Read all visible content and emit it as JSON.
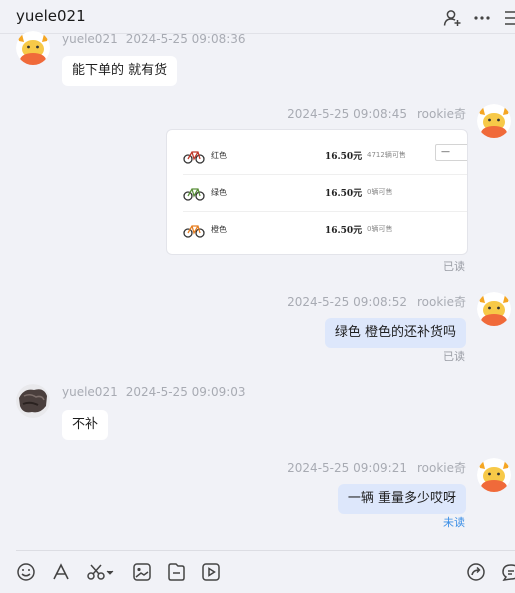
{
  "header": {
    "title": "yuele021",
    "icons": [
      "add-contact-icon",
      "more-icon",
      "menu-icon"
    ]
  },
  "messages": [
    {
      "sender": "yuele021",
      "time": "2024-5-25 09:08:36",
      "side": "left",
      "avatar": "ox-avatar",
      "text": "能下单的 就有货"
    },
    {
      "sender": "rookie奇",
      "time": "2024-5-25 09:08:45",
      "side": "right",
      "avatar": "ox-avatar",
      "type": "product-card",
      "card": {
        "rows": [
          {
            "color": "红色",
            "price": "16.50元",
            "stock": "4712辆可售",
            "qty": "—"
          },
          {
            "color": "绿色",
            "price": "16.50元",
            "stock": "0辆可售",
            "qty": ""
          },
          {
            "color": "橙色",
            "price": "16.50元",
            "stock": "0辆可售",
            "qty": ""
          }
        ]
      },
      "status": "已读"
    },
    {
      "sender": "rookie奇",
      "time": "2024-5-25 09:08:52",
      "side": "right",
      "avatar": "ox-avatar",
      "text": "绿色  橙色的还补货吗",
      "status": "已读"
    },
    {
      "sender": "yuele021",
      "time": "2024-5-25 09:09:03",
      "side": "left",
      "avatar": "photo-avatar",
      "text": "不补"
    },
    {
      "sender": "rookie奇",
      "time": "2024-5-25 09:09:21",
      "side": "right",
      "avatar": "ox-avatar",
      "text": "一辆 重量多少哎呀",
      "status": "未读"
    }
  ],
  "colors": {
    "background": "#f1f2f7",
    "outgoing_bubble": "#dde7fb",
    "incoming_bubble": "#ffffff",
    "unread": "#3a8ee6"
  },
  "toolbar": {
    "icons": [
      "emoji-icon",
      "font-icon",
      "screenshot-icon",
      "image-icon",
      "file-icon",
      "video-icon",
      "share-icon",
      "quick-reply-icon"
    ]
  }
}
